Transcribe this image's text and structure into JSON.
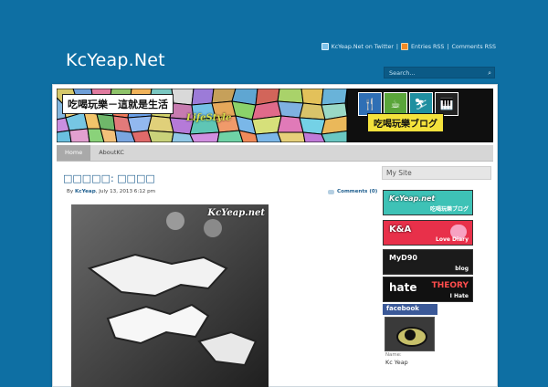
{
  "header": {
    "site_title": "KcYeap.Net",
    "top_links": {
      "twitter": "KcYeap.Net on Twitter",
      "entries_rss": "Entries RSS",
      "comments_rss": "Comments RSS",
      "separator": "|"
    },
    "search": {
      "placeholder": "Search..."
    }
  },
  "banner": {
    "left_title": "吃喝玩樂－這就是生活",
    "lifestyle": "LifeStyle",
    "right_title": "吃喝玩樂ブログ"
  },
  "nav": {
    "items": [
      {
        "label": "Home",
        "active": true
      },
      {
        "label": "AboutKC",
        "active": false
      }
    ]
  },
  "post": {
    "title": "□□□□□: □□□□",
    "meta_by": "By",
    "author": "KcYeap",
    "date": ", July 13, 2013 6:12 pm",
    "comments": "Comments (0)",
    "image_watermark": "KcYeap.net"
  },
  "sidebar": {
    "title": "My Site",
    "banners": [
      {
        "label": "KcYeap.net",
        "sub": "吃喝玩樂ブログ"
      },
      {
        "label": "K&A",
        "sub": "Love Diary"
      },
      {
        "label": "MyD90",
        "sub": "blog"
      },
      {
        "label": "hate",
        "sub": "I Hate",
        "extra": "THEORY"
      }
    ],
    "facebook": {
      "label": "facebook",
      "name_label": "Name:",
      "name": "Kc Yeap"
    }
  },
  "colors": {
    "background": "#0e6fa3",
    "link": "#1f5f8f",
    "nav_bg": "#d6d6d6",
    "nav_active": "#a9a9a9",
    "facebook": "#3b5998"
  }
}
